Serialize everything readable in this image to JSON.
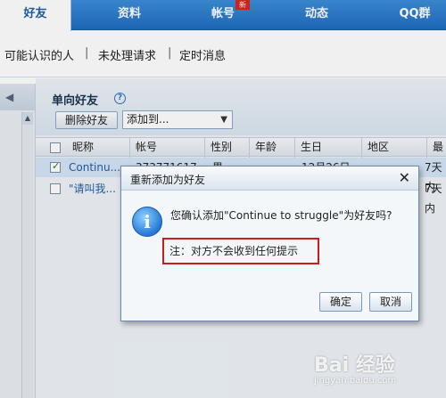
{
  "topnav": {
    "tabs": [
      {
        "label": "好友",
        "active": true
      },
      {
        "label": "资料",
        "active": false
      },
      {
        "label": "帐号",
        "active": false,
        "badge": "新"
      },
      {
        "label": "动态",
        "active": false
      },
      {
        "label": "QQ群",
        "active": false
      }
    ]
  },
  "subnav": {
    "items": [
      "可能认识的人",
      "未处理请求",
      "定时消息"
    ],
    "separator": "|"
  },
  "main": {
    "title": "单向好友",
    "help_icon": "?",
    "delete_button": "删除好友",
    "add_to_select": "添加到...",
    "columns": [
      "昵称",
      "帐号",
      "性别",
      "年龄",
      "生日",
      "地区",
      "最"
    ],
    "rows": [
      {
        "checked": true,
        "nickname": "Continu...",
        "account": "373771617",
        "gender": "男",
        "age": "",
        "birthday": "12月26日",
        "region": "",
        "last": "7天内"
      },
      {
        "checked": false,
        "nickname": "\"请叫我...",
        "account": "",
        "gender": "",
        "age": "",
        "birthday": "",
        "region": "",
        "last": "7天内"
      }
    ]
  },
  "dialog": {
    "title": "重新添加为好友",
    "close": "✕",
    "info_icon": "i",
    "message": "您确认添加\"Continue to struggle\"为好友吗?",
    "note": "注：对方不会收到任何提示",
    "ok": "确定",
    "cancel": "取消"
  },
  "watermark": {
    "text": "Bai  经验",
    "sub": "jingyan.baidu.com"
  },
  "colors": {
    "nav_blue": "#2f7ccf",
    "highlight_red": "#c81e1e"
  }
}
